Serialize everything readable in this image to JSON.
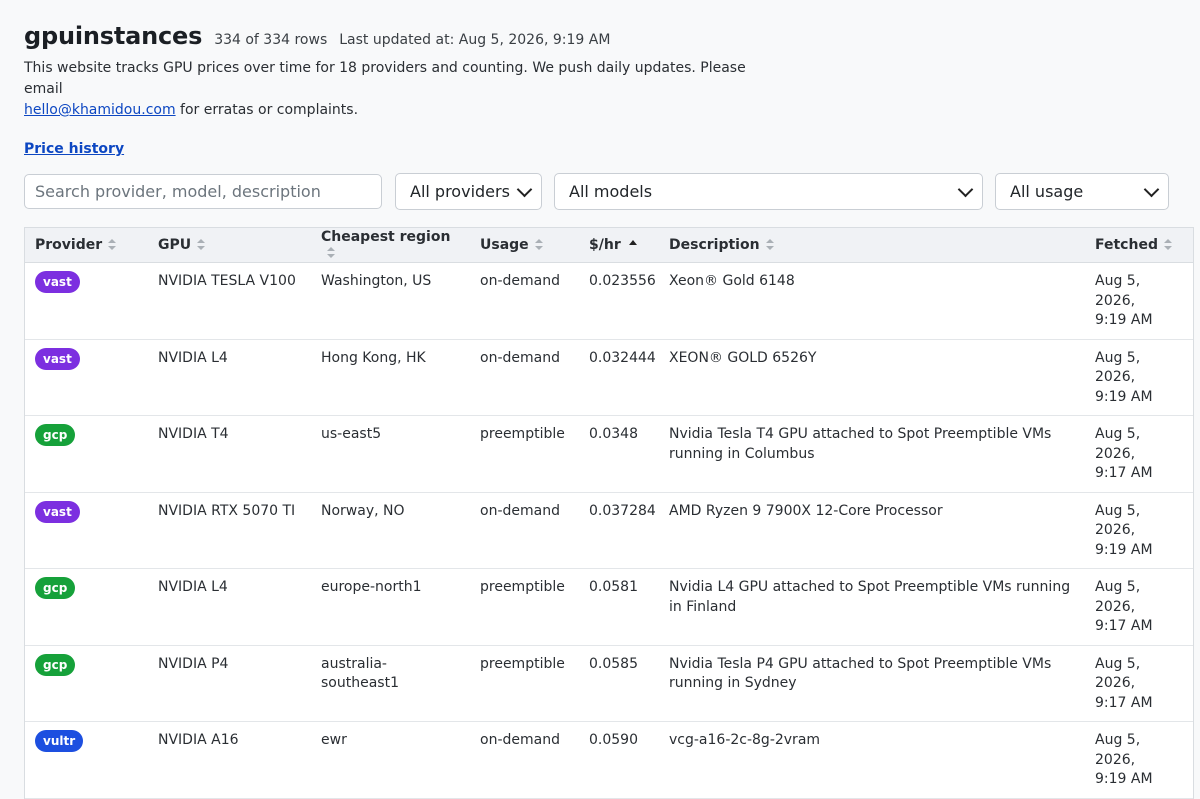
{
  "header": {
    "title": "gpuinstances",
    "rows_text": "334 of 334 rows",
    "updated_text": "Last updated at: Aug 5, 2026, 9:19 AM",
    "desc_part1": "This website tracks GPU prices over time for 18 providers and counting. We push daily updates. Please email",
    "email": "hello@khamidou.com",
    "desc_part2": " for erratas or complaints.",
    "history_link": "Price history"
  },
  "filters": {
    "search_placeholder": "Search provider, model, description",
    "providers": "All providers",
    "models": "All models",
    "usage": "All usage"
  },
  "table": {
    "columns": [
      "Provider",
      "GPU",
      "Cheapest region",
      "Usage",
      "$/hr",
      "Description",
      "Fetched"
    ],
    "rows": [
      {
        "provider": "vast",
        "gpu": "NVIDIA TESLA V100",
        "region": "Washington, US",
        "usage": "on-demand",
        "price": "0.023556",
        "description": "Xeon® Gold 6148",
        "fetched_date": "Aug 5, 2026,",
        "fetched_time": "9:19 AM"
      },
      {
        "provider": "vast",
        "gpu": "NVIDIA L4",
        "region": "Hong Kong, HK",
        "usage": "on-demand",
        "price": "0.032444",
        "description": "XEON® GOLD 6526Y",
        "fetched_date": "Aug 5, 2026,",
        "fetched_time": "9:19 AM"
      },
      {
        "provider": "gcp",
        "gpu": "NVIDIA T4",
        "region": "us-east5",
        "usage": "preemptible",
        "price": "0.0348",
        "description": "Nvidia Tesla T4 GPU attached to Spot Preemptible VMs running in Columbus",
        "fetched_date": "Aug 5, 2026,",
        "fetched_time": "9:17 AM"
      },
      {
        "provider": "vast",
        "gpu": "NVIDIA RTX 5070 TI",
        "region": "Norway, NO",
        "usage": "on-demand",
        "price": "0.037284",
        "description": "AMD Ryzen 9 7900X 12-Core Processor",
        "fetched_date": "Aug 5, 2026,",
        "fetched_time": "9:19 AM"
      },
      {
        "provider": "gcp",
        "gpu": "NVIDIA L4",
        "region": "europe-north1",
        "usage": "preemptible",
        "price": "0.0581",
        "description": "Nvidia L4 GPU attached to Spot Preemptible VMs running in Finland",
        "fetched_date": "Aug 5, 2026,",
        "fetched_time": "9:17 AM"
      },
      {
        "provider": "gcp",
        "gpu": "NVIDIA P4",
        "region": "australia-southeast1",
        "usage": "preemptible",
        "price": "0.0585",
        "description": "Nvidia Tesla P4 GPU attached to Spot Preemptible VMs running in Sydney",
        "fetched_date": "Aug 5, 2026,",
        "fetched_time": "9:17 AM"
      },
      {
        "provider": "vultr",
        "gpu": "NVIDIA A16",
        "region": "ewr",
        "usage": "on-demand",
        "price": "0.0590",
        "description": "vcg-a16-2c-8g-2vram",
        "fetched_date": "Aug 5, 2026,",
        "fetched_time": "9:19 AM"
      }
    ]
  },
  "colors": {
    "vast": "#7c2fe0",
    "gcp": "#16a13a",
    "vultr": "#1d4fe0",
    "link": "#0d47c2"
  }
}
